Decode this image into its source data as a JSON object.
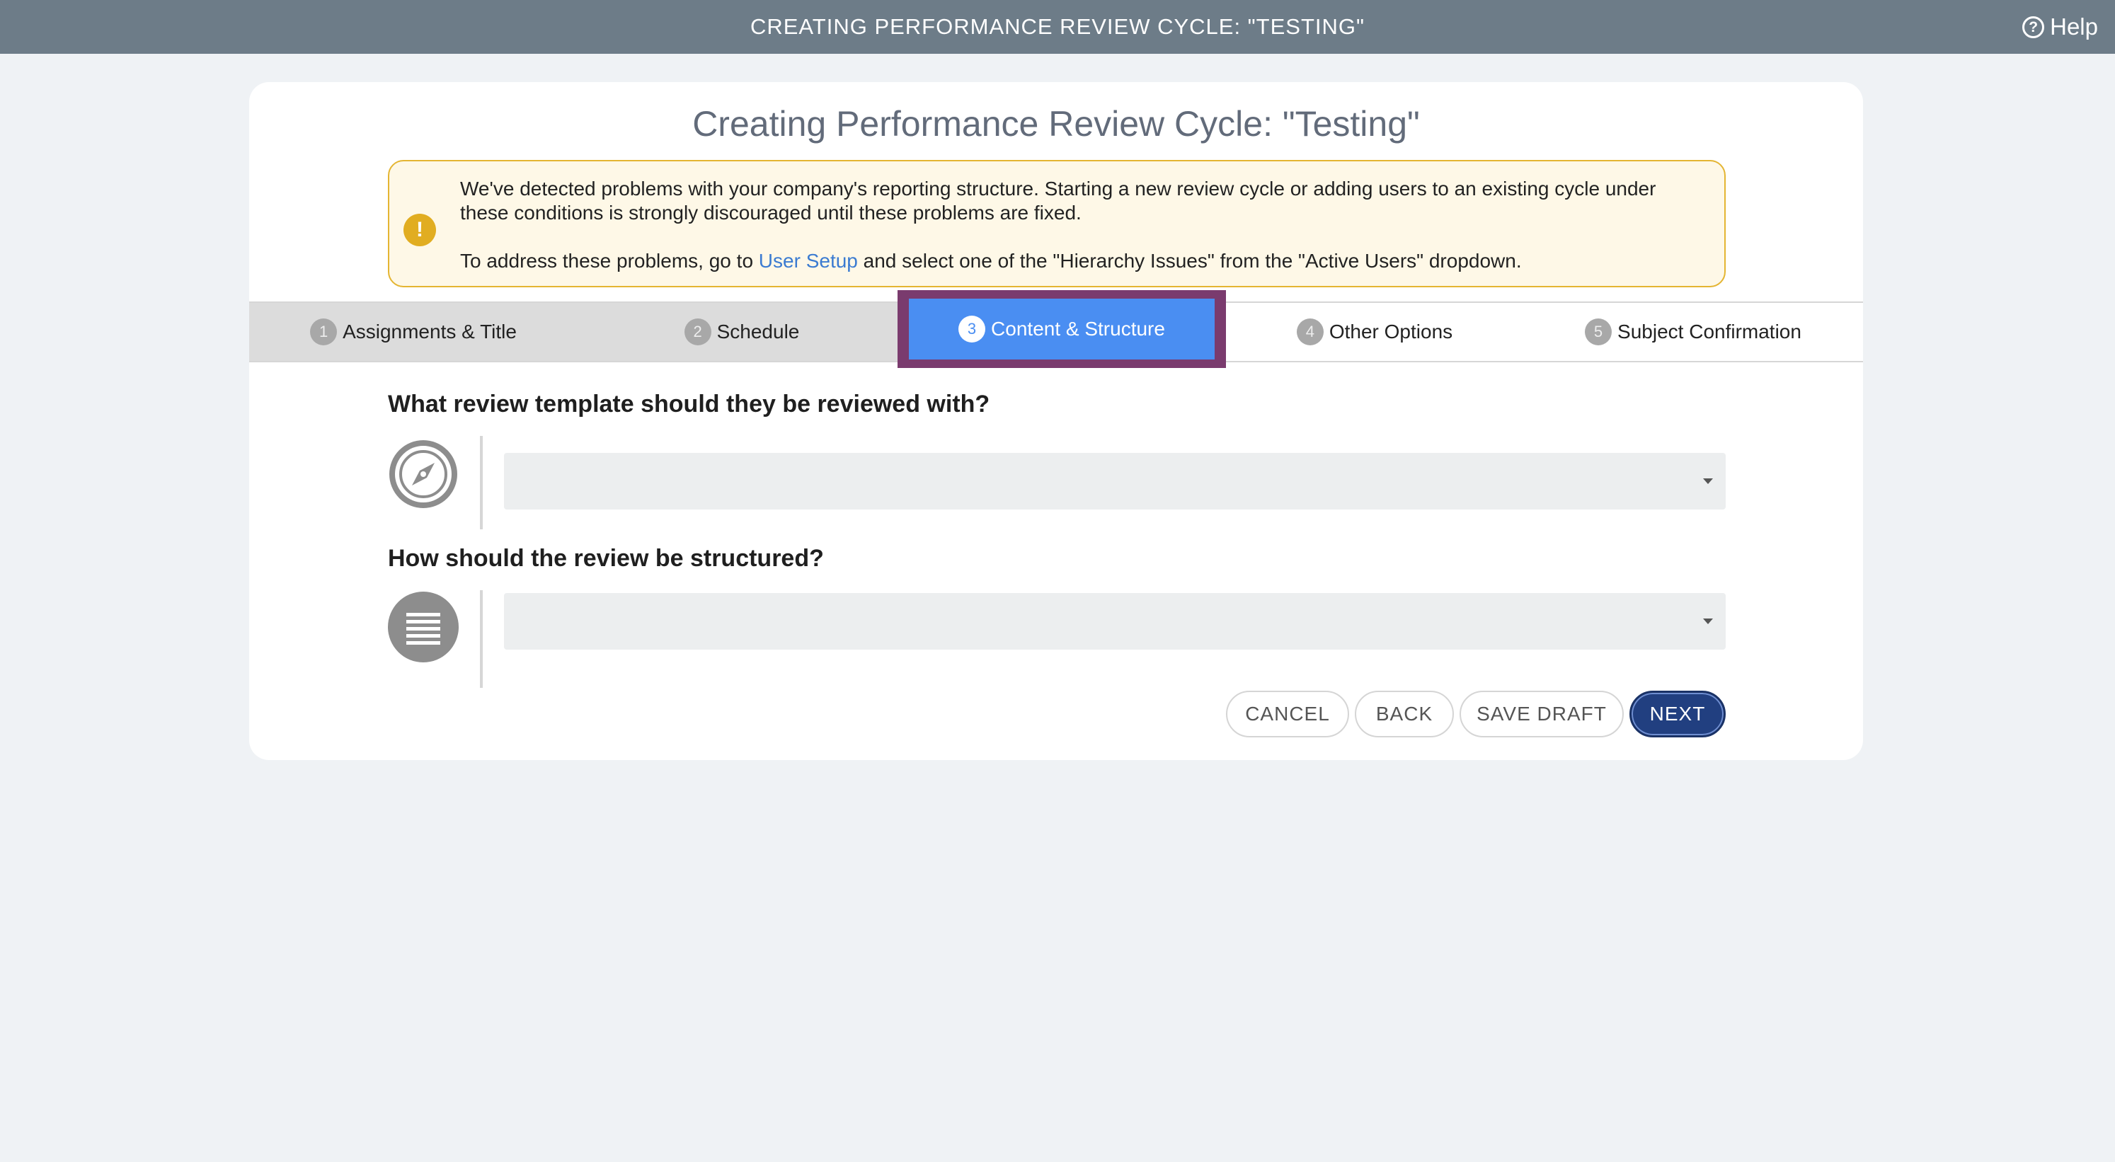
{
  "topbar": {
    "title": "CREATING PERFORMANCE REVIEW CYCLE: \"TESTING\"",
    "help_label": "Help"
  },
  "card": {
    "title": "Creating Performance Review Cycle: \"Testing\""
  },
  "alert": {
    "line1": "We've detected problems with your company's reporting structure. Starting a new review cycle or adding users to an existing cycle under these conditions is strongly discouraged until these problems are fixed.",
    "line2_prefix": "To address these problems, go to ",
    "line2_link": "User Setup",
    "line2_suffix": " and select one of the \"Hierarchy Issues\" from the \"Active Users\" dropdown.",
    "icon": "exclamation-icon",
    "color": "#e1ad21"
  },
  "steps": [
    {
      "num": "1",
      "label": "Assignments & Title"
    },
    {
      "num": "2",
      "label": "Schedule"
    },
    {
      "num": "3",
      "label": "Content & Structure"
    },
    {
      "num": "4",
      "label": "Other Options"
    },
    {
      "num": "5",
      "label": "Subject Confirmation"
    }
  ],
  "active_step_color": "#4a8ef2",
  "questions": {
    "template": {
      "label": "What review template should they be reviewed with?",
      "icon": "compass-icon",
      "selected": ""
    },
    "structure": {
      "label": "How should the review be structured?",
      "icon": "list-icon",
      "selected": ""
    }
  },
  "buttons": {
    "cancel": "CANCEL",
    "back": "BACK",
    "save_draft": "SAVE DRAFT",
    "next": "NEXT",
    "next_color": "#213f80"
  }
}
